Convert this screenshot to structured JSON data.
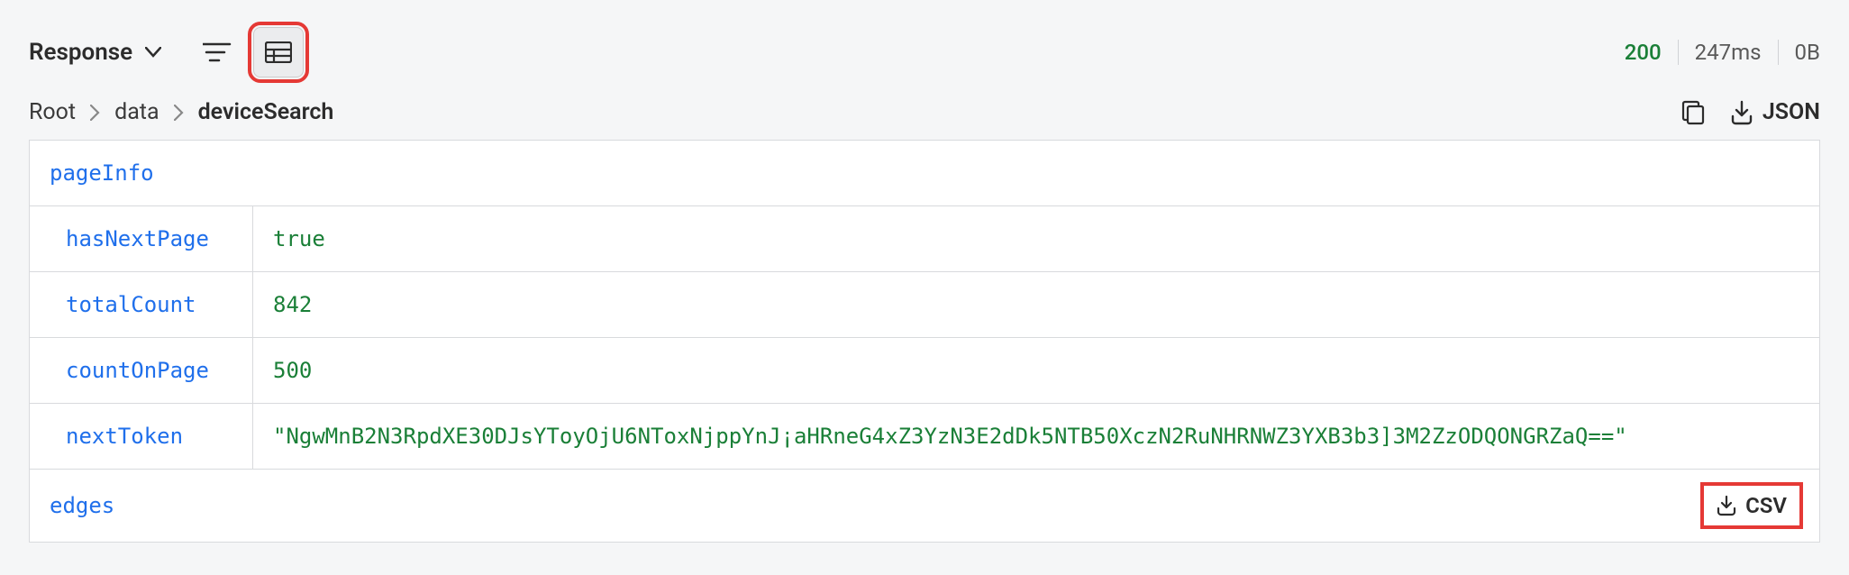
{
  "header": {
    "title": "Response",
    "status_code": "200",
    "timing": "247ms",
    "size": "0B"
  },
  "breadcrumb": {
    "root": "Root",
    "data": "data",
    "current": "deviceSearch"
  },
  "actions": {
    "json_label": "JSON"
  },
  "result": {
    "pageInfo_label": "pageInfo",
    "hasNextPage": {
      "key": "hasNextPage",
      "value": "true"
    },
    "totalCount": {
      "key": "totalCount",
      "value": "842"
    },
    "countOnPage": {
      "key": "countOnPage",
      "value": "500"
    },
    "nextToken": {
      "key": "nextToken",
      "value": "\"NgwMnB2N3RpdXE30DJsYToyOjU6NToxNjppYnJ¡aHRneG4xZ3YzN3E2dDk5NTB50XczN2RuNHRNWZ3YXB3b3]3M2ZzODQONGRZaQ==\""
    },
    "edges_label": "edges",
    "csv_label": "CSV"
  }
}
